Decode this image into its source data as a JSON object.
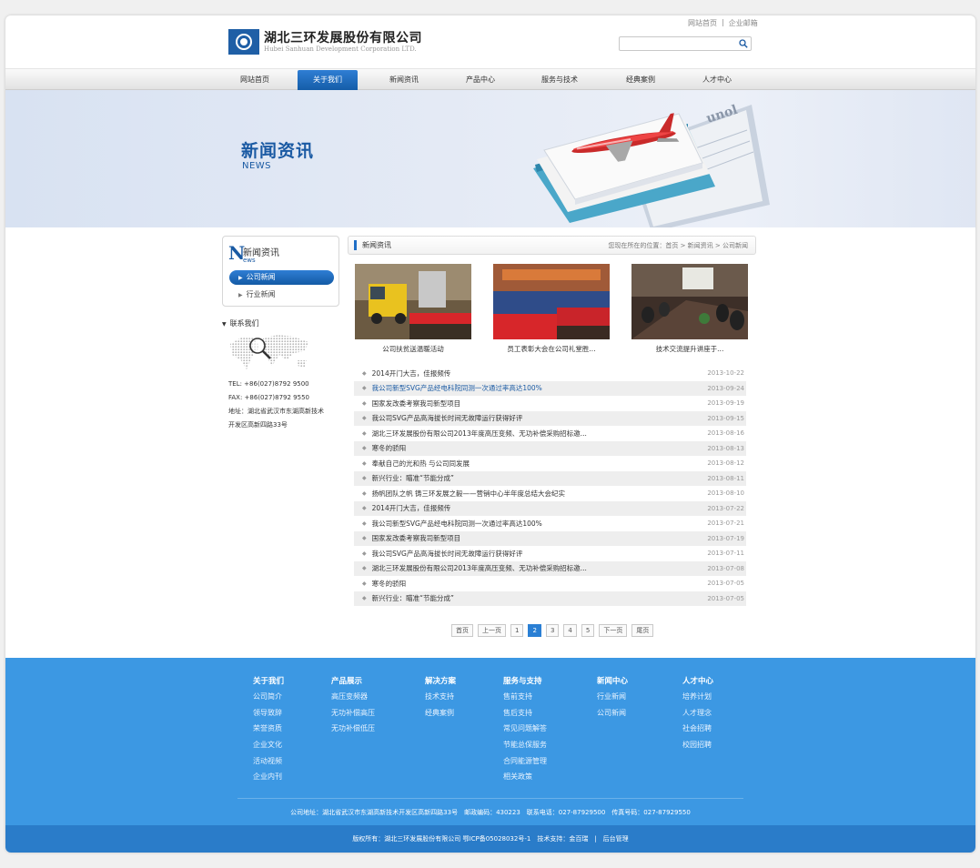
{
  "header": {
    "logo_cn": "湖北三环发展股份有限公司",
    "logo_en": "Hubei Sanhuan Development Corporation LTD.",
    "top_links": [
      "网站首页",
      "|",
      "企业邮箱"
    ],
    "search": {
      "value": "",
      "placeholder": ""
    }
  },
  "nav": {
    "items": [
      "网站首页",
      "关于我们",
      "新闻资讯",
      "产品中心",
      "服务与技术",
      "经典案例",
      "人才中心"
    ],
    "active_index": 1
  },
  "banner": {
    "title": "新闻资讯",
    "subtitle": "NEWS"
  },
  "sidebar": {
    "box_initial": "N",
    "box_title": "新闻资讯",
    "box_subtitle": "ews",
    "items": [
      "公司新闻",
      "行业新闻"
    ],
    "contact_title": "联系我们",
    "contact": {
      "tel": "TEL: +86(027)8792 9500",
      "fax": "FAX: +86(027)8792 9550",
      "addr1": "地址：湖北省武汉市东湖高新技术",
      "addr2": "开发区高新四路33号"
    }
  },
  "main": {
    "section_title": "新闻资讯",
    "breadcrumb": "您现在所在的位置：首页 > 新闻资讯 > 公司新闻",
    "photos": [
      {
        "caption": "公司扶贫送温暖活动"
      },
      {
        "caption": "员工表彰大会在公司礼堂胜..."
      },
      {
        "caption": "技术交流提升讲座于..."
      }
    ],
    "news": [
      {
        "title": "2014开门大吉，佳报频传",
        "date": "2013-10-22",
        "link": false
      },
      {
        "title": "我公司新型SVG产品经电科院同测一次通过率高达100%",
        "date": "2013-09-24",
        "link": true
      },
      {
        "title": "国家发改委考察我司新型项目",
        "date": "2013-09-19",
        "link": false
      },
      {
        "title": "我公司SVG产品高海拔长时间无故障运行获得好评",
        "date": "2013-09-15",
        "link": false
      },
      {
        "title": "湖北三环发展股份有限公司2013年度高压变频、无功补偿采购招标邀...",
        "date": "2013-08-16",
        "link": false
      },
      {
        "title": "寒冬的骄阳",
        "date": "2013-08-13",
        "link": false
      },
      {
        "title": "奉献自己的光和热 与公司同发展",
        "date": "2013-08-12",
        "link": false
      },
      {
        "title": "新兴行业：瞄准“节能分成”",
        "date": "2013-08-11",
        "link": false
      },
      {
        "title": "扬帆团队之帆 铸三环发展之毅——营销中心半年度总结大会纪实",
        "date": "2013-08-10",
        "link": false
      },
      {
        "title": "2014开门大吉，佳报频传",
        "date": "2013-07-22",
        "link": false
      },
      {
        "title": "我公司新型SVG产品经电科院同测一次通过率高达100%",
        "date": "2013-07-21",
        "link": false
      },
      {
        "title": "国家发改委考察我司新型项目",
        "date": "2013-07-19",
        "link": false
      },
      {
        "title": "我公司SVG产品高海拔长时间无故障运行获得好评",
        "date": "2013-07-11",
        "link": false
      },
      {
        "title": "湖北三环发展股份有限公司2013年度高压变频、无功补偿采购招标邀...",
        "date": "2013-07-08",
        "link": false
      },
      {
        "title": "寒冬的骄阳",
        "date": "2013-07-05",
        "link": false
      },
      {
        "title": "新兴行业：瞄准“节能分成”",
        "date": "2013-07-05",
        "link": false
      }
    ],
    "pager": [
      "首页",
      "上一页",
      "1",
      "2",
      "3",
      "4",
      "5",
      "下一页",
      "尾页"
    ],
    "current_page": "2"
  },
  "footer": {
    "columns": [
      {
        "title": "关于我们",
        "links": [
          "公司简介",
          "领导致辞",
          "荣誉资质",
          "企业文化",
          "活动视频",
          "企业内刊"
        ]
      },
      {
        "title": "产品展示",
        "links": [
          "高压变频器",
          "无功补偿高压",
          "无功补偿低压"
        ]
      },
      {
        "title": "解决方案",
        "links": [
          "技术支持",
          "经典案例"
        ]
      },
      {
        "title": "服务与支持",
        "links": [
          "售前支持",
          "售后支持",
          "常见问题解答",
          "节能总保服务",
          "合同能源管理",
          "相关政策"
        ]
      },
      {
        "title": "新闻中心",
        "links": [
          "行业新闻",
          "公司新闻"
        ]
      },
      {
        "title": "人才中心",
        "links": [
          "培养计划",
          "人才理念",
          "社会招聘",
          "校园招聘"
        ]
      }
    ],
    "address": "公司地址：湖北省武汉市东湖高新技术开发区高新四路33号　邮政编码：430223　联系电话：027-87929500　传真号码：027-87929550",
    "copyright": "版权所有：湖北三环发展股份有限公司 鄂ICP备05028032号-1　技术支持：金百瑞　|　后台管理"
  },
  "colors": {
    "brand_blue": "#1a5aa3",
    "footer_blue": "#3c98e3",
    "footer_dark": "#2a7cc9",
    "link_blue": "#1a5aa3"
  }
}
